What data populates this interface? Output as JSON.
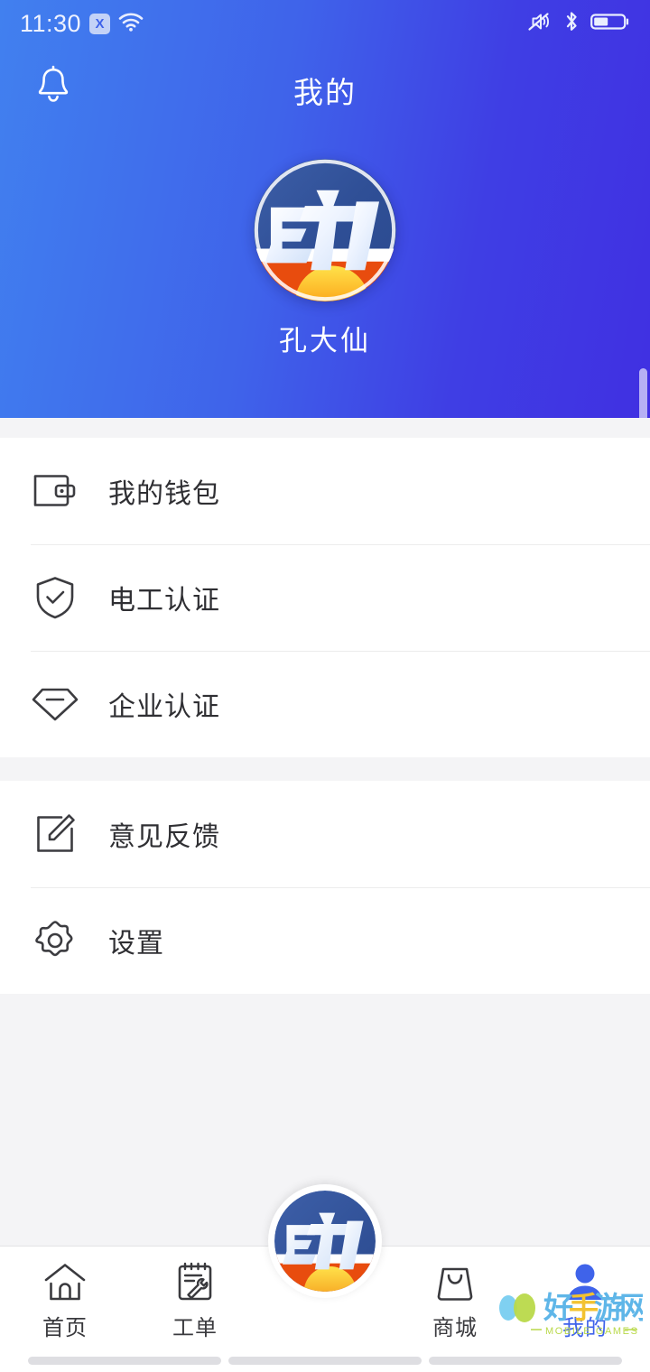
{
  "statusbar": {
    "time": "11:30",
    "x_badge": "X",
    "wifi_icon": "wifi-icon",
    "mute_icon": "volume-mute-icon",
    "bluetooth_icon": "bluetooth-icon",
    "battery_icon": "battery-half-icon"
  },
  "header": {
    "title": "我的",
    "bell_icon": "bell-icon",
    "username": "孔大仙",
    "avatar_alt": "电 logo avatar",
    "gradient_from": "#4180ef",
    "gradient_to": "#4030e2"
  },
  "menu": {
    "group1": [
      {
        "label": "我的钱包",
        "icon": "wallet-icon"
      },
      {
        "label": "电工认证",
        "icon": "shield-check-icon"
      },
      {
        "label": "企业认证",
        "icon": "diamond-icon"
      }
    ],
    "group2": [
      {
        "label": "意见反馈",
        "icon": "edit-square-icon"
      },
      {
        "label": "设置",
        "icon": "gear-icon"
      }
    ]
  },
  "tabbar": {
    "items": [
      {
        "label": "首页",
        "icon": "home-icon",
        "active": false
      },
      {
        "label": "工单",
        "icon": "clipboard-wrench-icon",
        "active": false
      },
      {
        "label": "商城",
        "icon": "shopping-bag-icon",
        "active": false
      },
      {
        "label": "我的",
        "icon": "person-icon",
        "active": true
      }
    ],
    "center_button": "app-logo-fab",
    "active_color": "#3f63ea"
  },
  "watermark": {
    "text": "好手游网",
    "subtitle": "MOBILE GAMES"
  }
}
